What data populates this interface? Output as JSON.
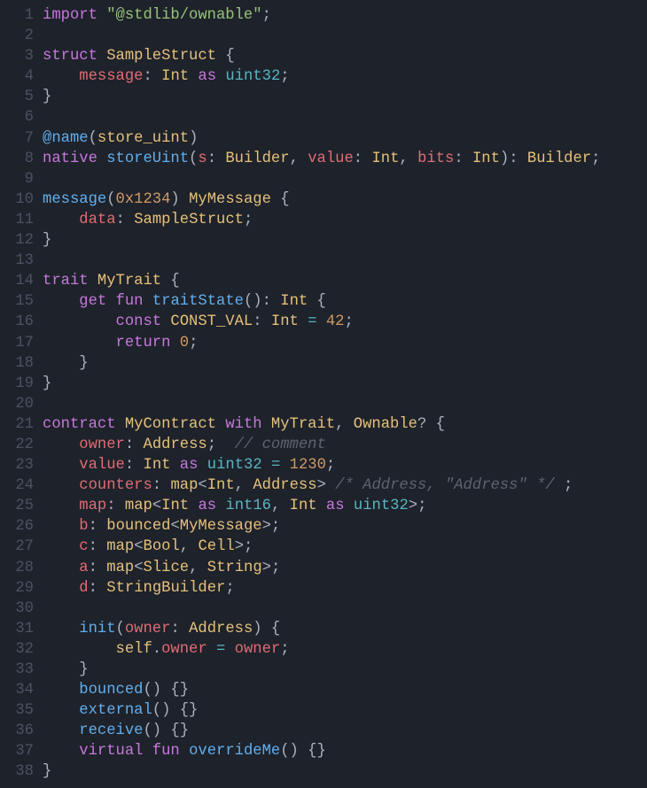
{
  "code": {
    "language": "tact",
    "line_count": 38,
    "lines": {
      "l1": [
        [
          "import",
          "kw"
        ],
        [
          " ",
          "p"
        ],
        [
          "\"@stdlib/ownable\"",
          "str"
        ],
        [
          ";",
          "p"
        ]
      ],
      "l2": [
        [
          "",
          "p"
        ]
      ],
      "l3": [
        [
          "struct",
          "kw"
        ],
        [
          " ",
          "p"
        ],
        [
          "SampleStruct",
          "id"
        ],
        [
          " {",
          "p"
        ]
      ],
      "l4": [
        [
          "    ",
          "p"
        ],
        [
          "message",
          "var"
        ],
        [
          ":",
          "p"
        ],
        [
          " ",
          "p"
        ],
        [
          "Int",
          "id"
        ],
        [
          " ",
          "p"
        ],
        [
          "as",
          "kw"
        ],
        [
          " ",
          "p"
        ],
        [
          "uint32",
          "t1"
        ],
        [
          ";",
          "p"
        ]
      ],
      "l5": [
        [
          "}",
          "p"
        ]
      ],
      "l6": [
        [
          "",
          "p"
        ]
      ],
      "l7": [
        [
          "@name",
          "fn"
        ],
        [
          "(",
          "p"
        ],
        [
          "store_uint",
          "id"
        ],
        [
          ")",
          "p"
        ]
      ],
      "l8": [
        [
          "native",
          "kw"
        ],
        [
          " ",
          "p"
        ],
        [
          "storeUint",
          "fn"
        ],
        [
          "(",
          "p"
        ],
        [
          "s",
          "var"
        ],
        [
          ":",
          "p"
        ],
        [
          " ",
          "p"
        ],
        [
          "Builder",
          "id"
        ],
        [
          ",",
          "p"
        ],
        [
          " ",
          "p"
        ],
        [
          "value",
          "var"
        ],
        [
          ":",
          "p"
        ],
        [
          " ",
          "p"
        ],
        [
          "Int",
          "id"
        ],
        [
          ",",
          "p"
        ],
        [
          " ",
          "p"
        ],
        [
          "bits",
          "var"
        ],
        [
          ":",
          "p"
        ],
        [
          " ",
          "p"
        ],
        [
          "Int",
          "id"
        ],
        [
          "):",
          "p"
        ],
        [
          " ",
          "p"
        ],
        [
          "Builder",
          "id"
        ],
        [
          ";",
          "p"
        ]
      ],
      "l9": [
        [
          "",
          "p"
        ]
      ],
      "l10": [
        [
          "message",
          "fn"
        ],
        [
          "(",
          "p"
        ],
        [
          "0x1234",
          "num"
        ],
        [
          ")",
          "p"
        ],
        [
          " ",
          "p"
        ],
        [
          "MyMessage",
          "id"
        ],
        [
          " {",
          "p"
        ]
      ],
      "l11": [
        [
          "    ",
          "p"
        ],
        [
          "data",
          "var"
        ],
        [
          ":",
          "p"
        ],
        [
          " ",
          "p"
        ],
        [
          "SampleStruct",
          "id"
        ],
        [
          ";",
          "p"
        ]
      ],
      "l12": [
        [
          "}",
          "p"
        ]
      ],
      "l13": [
        [
          "",
          "p"
        ]
      ],
      "l14": [
        [
          "trait",
          "kw"
        ],
        [
          " ",
          "p"
        ],
        [
          "MyTrait",
          "id"
        ],
        [
          " {",
          "p"
        ]
      ],
      "l15": [
        [
          "    ",
          "p"
        ],
        [
          "get",
          "kw"
        ],
        [
          " ",
          "p"
        ],
        [
          "fun",
          "kw"
        ],
        [
          " ",
          "p"
        ],
        [
          "traitState",
          "fn"
        ],
        [
          "():",
          "p"
        ],
        [
          " ",
          "p"
        ],
        [
          "Int",
          "id"
        ],
        [
          " {",
          "p"
        ]
      ],
      "l16": [
        [
          "        ",
          "p"
        ],
        [
          "const",
          "kw"
        ],
        [
          " ",
          "p"
        ],
        [
          "CONST_VAL",
          "id"
        ],
        [
          ":",
          "p"
        ],
        [
          " ",
          "p"
        ],
        [
          "Int",
          "id"
        ],
        [
          " ",
          "p"
        ],
        [
          "=",
          "op"
        ],
        [
          " ",
          "p"
        ],
        [
          "42",
          "num"
        ],
        [
          ";",
          "p"
        ]
      ],
      "l17": [
        [
          "        ",
          "p"
        ],
        [
          "return",
          "kw"
        ],
        [
          " ",
          "p"
        ],
        [
          "0",
          "num"
        ],
        [
          ";",
          "p"
        ]
      ],
      "l18": [
        [
          "    }",
          "p"
        ]
      ],
      "l19": [
        [
          "}",
          "p"
        ]
      ],
      "l20": [
        [
          "",
          "p"
        ]
      ],
      "l21": [
        [
          "contract",
          "kw"
        ],
        [
          " ",
          "p"
        ],
        [
          "MyContract",
          "id"
        ],
        [
          " ",
          "p"
        ],
        [
          "with",
          "kw"
        ],
        [
          " ",
          "p"
        ],
        [
          "MyTrait",
          "id"
        ],
        [
          ",",
          "p"
        ],
        [
          " ",
          "p"
        ],
        [
          "Ownable",
          "id"
        ],
        [
          "?",
          "p"
        ],
        [
          " {",
          "p"
        ]
      ],
      "l22": [
        [
          "    ",
          "p"
        ],
        [
          "owner",
          "var"
        ],
        [
          ":",
          "p"
        ],
        [
          " ",
          "p"
        ],
        [
          "Address",
          "id"
        ],
        [
          ";",
          "p"
        ],
        [
          "  ",
          "p"
        ],
        [
          "// comment",
          "cmt"
        ]
      ],
      "l23": [
        [
          "    ",
          "p"
        ],
        [
          "value",
          "var"
        ],
        [
          ":",
          "p"
        ],
        [
          " ",
          "p"
        ],
        [
          "Int",
          "id"
        ],
        [
          " ",
          "p"
        ],
        [
          "as",
          "kw"
        ],
        [
          " ",
          "p"
        ],
        [
          "uint32",
          "t1"
        ],
        [
          " ",
          "p"
        ],
        [
          "=",
          "op"
        ],
        [
          " ",
          "p"
        ],
        [
          "1230",
          "num"
        ],
        [
          ";",
          "p"
        ]
      ],
      "l24": [
        [
          "    ",
          "p"
        ],
        [
          "counters",
          "var"
        ],
        [
          ":",
          "p"
        ],
        [
          " ",
          "p"
        ],
        [
          "map",
          "id"
        ],
        [
          "<",
          "p"
        ],
        [
          "Int",
          "id"
        ],
        [
          ",",
          "p"
        ],
        [
          " ",
          "p"
        ],
        [
          "Address",
          "id"
        ],
        [
          ">",
          "p"
        ],
        [
          " ",
          "p"
        ],
        [
          "/* Address, \"Address\" */",
          "cmt"
        ],
        [
          " ;",
          "p"
        ]
      ],
      "l25": [
        [
          "    ",
          "p"
        ],
        [
          "map",
          "var"
        ],
        [
          ":",
          "p"
        ],
        [
          " ",
          "p"
        ],
        [
          "map",
          "id"
        ],
        [
          "<",
          "p"
        ],
        [
          "Int",
          "id"
        ],
        [
          " ",
          "p"
        ],
        [
          "as",
          "kw"
        ],
        [
          " ",
          "p"
        ],
        [
          "int16",
          "t1"
        ],
        [
          ",",
          "p"
        ],
        [
          " ",
          "p"
        ],
        [
          "Int",
          "id"
        ],
        [
          " ",
          "p"
        ],
        [
          "as",
          "kw"
        ],
        [
          " ",
          "p"
        ],
        [
          "uint32",
          "t1"
        ],
        [
          ">;",
          "p"
        ]
      ],
      "l26": [
        [
          "    ",
          "p"
        ],
        [
          "b",
          "var"
        ],
        [
          ":",
          "p"
        ],
        [
          " ",
          "p"
        ],
        [
          "bounced",
          "id"
        ],
        [
          "<",
          "p"
        ],
        [
          "MyMessage",
          "id"
        ],
        [
          ">;",
          "p"
        ]
      ],
      "l27": [
        [
          "    ",
          "p"
        ],
        [
          "c",
          "var"
        ],
        [
          ":",
          "p"
        ],
        [
          " ",
          "p"
        ],
        [
          "map",
          "id"
        ],
        [
          "<",
          "p"
        ],
        [
          "Bool",
          "id"
        ],
        [
          ",",
          "p"
        ],
        [
          " ",
          "p"
        ],
        [
          "Cell",
          "id"
        ],
        [
          ">;",
          "p"
        ]
      ],
      "l28": [
        [
          "    ",
          "p"
        ],
        [
          "a",
          "var"
        ],
        [
          ":",
          "p"
        ],
        [
          " ",
          "p"
        ],
        [
          "map",
          "id"
        ],
        [
          "<",
          "p"
        ],
        [
          "Slice",
          "id"
        ],
        [
          ",",
          "p"
        ],
        [
          " ",
          "p"
        ],
        [
          "String",
          "id"
        ],
        [
          ">;",
          "p"
        ]
      ],
      "l29": [
        [
          "    ",
          "p"
        ],
        [
          "d",
          "var"
        ],
        [
          ":",
          "p"
        ],
        [
          " ",
          "p"
        ],
        [
          "StringBuilder",
          "id"
        ],
        [
          ";",
          "p"
        ]
      ],
      "l30": [
        [
          "",
          "p"
        ]
      ],
      "l31": [
        [
          "    ",
          "p"
        ],
        [
          "init",
          "fn"
        ],
        [
          "(",
          "p"
        ],
        [
          "owner",
          "var"
        ],
        [
          ":",
          "p"
        ],
        [
          " ",
          "p"
        ],
        [
          "Address",
          "id"
        ],
        [
          ") {",
          "p"
        ]
      ],
      "l32": [
        [
          "        ",
          "p"
        ],
        [
          "self",
          "id"
        ],
        [
          ".",
          "p"
        ],
        [
          "owner",
          "var"
        ],
        [
          " ",
          "p"
        ],
        [
          "=",
          "op"
        ],
        [
          " ",
          "p"
        ],
        [
          "owner",
          "var"
        ],
        [
          ";",
          "p"
        ]
      ],
      "l33": [
        [
          "    }",
          "p"
        ]
      ],
      "l34": [
        [
          "    ",
          "p"
        ],
        [
          "bounced",
          "fn"
        ],
        [
          "() {}",
          "p"
        ]
      ],
      "l35": [
        [
          "    ",
          "p"
        ],
        [
          "external",
          "fn"
        ],
        [
          "() {}",
          "p"
        ]
      ],
      "l36": [
        [
          "    ",
          "p"
        ],
        [
          "receive",
          "fn"
        ],
        [
          "() {}",
          "p"
        ]
      ],
      "l37": [
        [
          "    ",
          "p"
        ],
        [
          "virtual",
          "kw"
        ],
        [
          " ",
          "p"
        ],
        [
          "fun",
          "kw"
        ],
        [
          " ",
          "p"
        ],
        [
          "overrideMe",
          "fn"
        ],
        [
          "() {}",
          "p"
        ]
      ],
      "l38": [
        [
          "}",
          "p"
        ]
      ]
    }
  }
}
